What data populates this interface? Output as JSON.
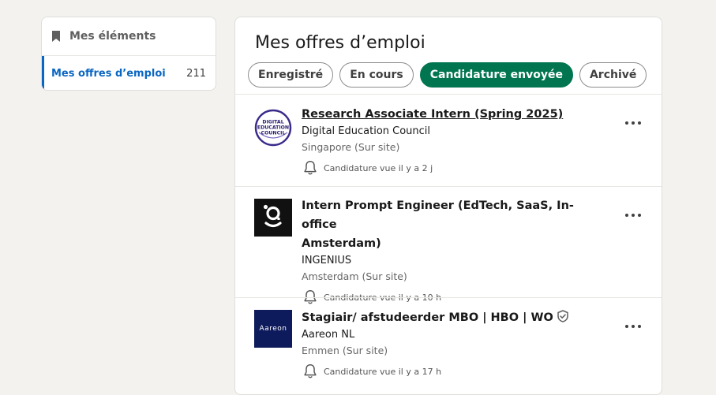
{
  "sidebar": {
    "title": "Mes éléments",
    "items": [
      {
        "label": "Mes offres d’emploi",
        "count": "211"
      }
    ]
  },
  "main": {
    "title": "Mes offres d’emploi",
    "tabs": [
      {
        "label": "Enregistré",
        "active": false
      },
      {
        "label": "En cours",
        "active": false
      },
      {
        "label": "Candidature envoyée",
        "active": true
      },
      {
        "label": "Archivé",
        "active": false
      }
    ],
    "jobs": [
      {
        "title": "Research Associate Intern (Spring 2025)",
        "company": "Digital Education Council",
        "location": "Singapore (Sur site)",
        "insight": "Candidature vue il y a 2 j",
        "logo_lines": [
          "DIGITAL",
          "EDUCATION",
          "COUNCIL"
        ]
      },
      {
        "title_line1": "Intern Prompt Engineer (EdTech, SaaS, In-office",
        "title_line2": "Amsterdam)",
        "company": "INGENIUS",
        "location": "Amsterdam (Sur site)",
        "insight": "Candidature vue il y a 10 h"
      },
      {
        "title": "Stagiair/ afstudeerder MBO | HBO | WO",
        "company": "Aareon NL",
        "location": "Emmen (Sur site)",
        "insight": "Candidature vue il y a 17 h",
        "logo_text": "Aareon"
      }
    ]
  },
  "colors": {
    "accent": "#0a66c2",
    "active_tab": "#01754f",
    "background": "#f4f2ee"
  },
  "icons": {
    "sidebar_header": "bookmark-icon",
    "insight": "bell-icon",
    "more": "ellipsis-icon",
    "verified": "shield-check-icon"
  }
}
